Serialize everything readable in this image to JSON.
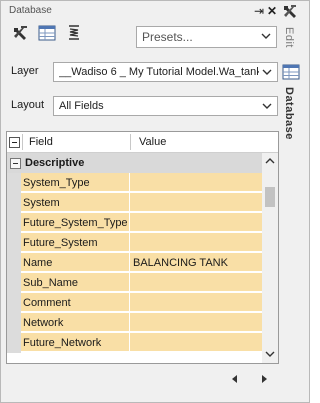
{
  "panel": {
    "title": "Database"
  },
  "toolbar": {
    "presets_label": "Presets...",
    "icons": [
      "tools-icon",
      "table-icon",
      "spring-icon"
    ]
  },
  "window": {
    "pin": "⇥",
    "close": "✕"
  },
  "tabs": {
    "edit": "Edit",
    "database": "Database"
  },
  "layer": {
    "label": "Layer",
    "value": "__Wadiso 6 _ My Tutorial Model.Wa_tank"
  },
  "layout": {
    "label": "Layout",
    "value": "All Fields"
  },
  "grid": {
    "header": {
      "field": "Field",
      "value": "Value"
    },
    "category": "Descriptive",
    "rows": [
      {
        "field": "System_Type",
        "value": ""
      },
      {
        "field": "System",
        "value": ""
      },
      {
        "field": "Future_System_Type",
        "value": ""
      },
      {
        "field": "Future_System",
        "value": ""
      },
      {
        "field": "Name",
        "value": "BALANCING TANK"
      },
      {
        "field": "Sub_Name",
        "value": ""
      },
      {
        "field": "Comment",
        "value": ""
      },
      {
        "field": "Network",
        "value": ""
      },
      {
        "field": "Future_Network",
        "value": ""
      }
    ]
  },
  "colors": {
    "field_bg": "#f9dfa6",
    "category_bg": "#d9d9d9"
  }
}
